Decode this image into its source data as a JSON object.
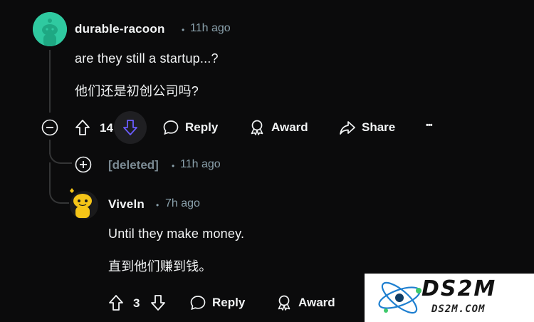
{
  "comment1": {
    "username": "durable-racoon",
    "separator": "•",
    "time": "11h ago",
    "line1": "are they still a startup...?",
    "line2": "他们还是初创公司吗?",
    "score": "14",
    "reply_label": "Reply",
    "award_label": "Award",
    "share_label": "Share",
    "more_label": "•••"
  },
  "deleted_comment": {
    "username": "[deleted]",
    "separator": "•",
    "time": "11h ago"
  },
  "comment2": {
    "username": "Viveln",
    "separator": "•",
    "time": "7h ago",
    "line1": "Until they make money.",
    "line2": "直到他们赚到钱。",
    "score": "3",
    "reply_label": "Reply",
    "award_label": "Award"
  },
  "watermark": {
    "main": "DS2M",
    "sub": "DS2M.COM"
  },
  "colors": {
    "background": "#0b0b0c",
    "downvote_active": "#6a5cff",
    "avatar_teal": "#2fc9a0",
    "avatar_yellow": "#f5c518"
  }
}
